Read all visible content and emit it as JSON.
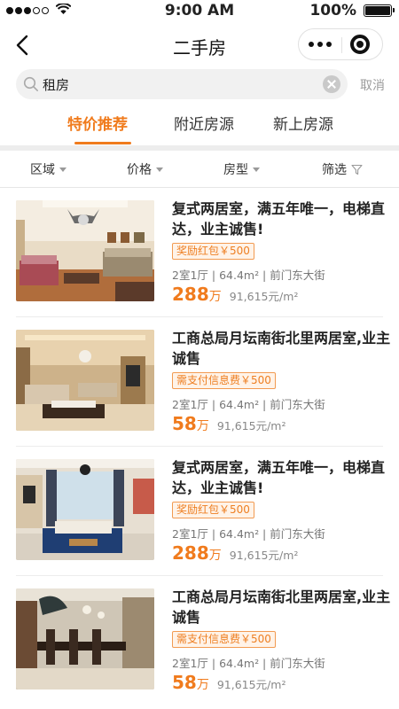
{
  "status": {
    "time": "9:00 AM",
    "battery": "100%"
  },
  "nav": {
    "title": "二手房"
  },
  "search": {
    "value": "租房",
    "cancel": "取消"
  },
  "tabs": [
    {
      "label": "特价推荐",
      "active": true
    },
    {
      "label": "附近房源",
      "active": false
    },
    {
      "label": "新上房源",
      "active": false
    }
  ],
  "filters": [
    {
      "label": "区域",
      "icon": "caret-down-icon"
    },
    {
      "label": "价格",
      "icon": "caret-down-icon"
    },
    {
      "label": "房型",
      "icon": "caret-down-icon"
    },
    {
      "label": "筛选",
      "icon": "funnel-icon"
    }
  ],
  "listings": [
    {
      "title": "复式两居室，满五年唯一，电梯直达，业主诚售!",
      "badge": "奖励红包￥500",
      "meta": "2室1厅 |  64.4m²  | 前门东大街",
      "price": "288",
      "unit": "万",
      "ppsqm": "91,615元/m²"
    },
    {
      "title": "工商总局月坛南街北里两居室,业主诚售",
      "badge": "需支付信息费￥500",
      "meta": "2室1厅 |  64.4m²  | 前门东大街",
      "price": "58",
      "unit": "万",
      "ppsqm": "91,615元/m²"
    },
    {
      "title": "复式两居室，满五年唯一，电梯直达，业主诚售!",
      "badge": "奖励红包￥500",
      "meta": "2室1厅 |  64.4m²  | 前门东大街",
      "price": "288",
      "unit": "万",
      "ppsqm": "91,615元/m²"
    },
    {
      "title": "工商总局月坛南街北里两居室,业主诚售",
      "badge": "需支付信息费￥500",
      "meta": "2室1厅 |  64.4m²  | 前门东大街",
      "price": "58",
      "unit": "万",
      "ppsqm": "91,615元/m²"
    }
  ],
  "colors": {
    "accent": "#f07b1d",
    "badge_bg": "#fff3e8"
  }
}
